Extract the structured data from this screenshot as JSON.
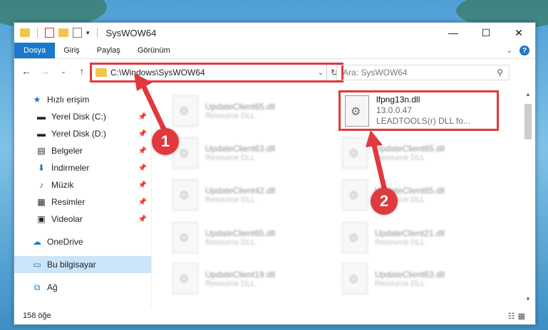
{
  "window": {
    "title": "SysWOW64"
  },
  "ribbon": {
    "tabs": [
      "Dosya",
      "Giriş",
      "Paylaş",
      "Görünüm"
    ]
  },
  "address": {
    "path": "C:\\Windows\\SysWOW64",
    "search_placeholder": "Ara: SysWOW64"
  },
  "sidebar": {
    "items": [
      {
        "label": "Hızlı erişim",
        "icon": "star-icon"
      },
      {
        "label": "Yerel Disk (C:)",
        "icon": "drive-icon"
      },
      {
        "label": "Yerel Disk (D:)",
        "icon": "drive-icon"
      },
      {
        "label": "Belgeler",
        "icon": "documents-icon"
      },
      {
        "label": "İndirmeler",
        "icon": "download-icon"
      },
      {
        "label": "Müzik",
        "icon": "music-icon"
      },
      {
        "label": "Resimler",
        "icon": "pictures-icon"
      },
      {
        "label": "Videolar",
        "icon": "videos-icon"
      },
      {
        "label": "OneDrive",
        "icon": "cloud-icon"
      },
      {
        "label": "Bu bilgisayar",
        "icon": "computer-icon"
      },
      {
        "label": "Ağ",
        "icon": "network-icon"
      }
    ]
  },
  "files_left": [
    {
      "name": "UpdateClient65.dll",
      "type": "Resource DLL"
    },
    {
      "name": "UpdateClient63.dll",
      "type": "Resource DLL"
    },
    {
      "name": "UpdateClient42.dll",
      "type": "Resource DLL"
    },
    {
      "name": "UpdateClient65.dll",
      "type": "Resource DLL"
    },
    {
      "name": "UpdateClient19.dll",
      "type": "Resource DLL"
    }
  ],
  "files_right": [
    {
      "name": "UpdateClient65.dll",
      "type": "Resource DLL"
    },
    {
      "name": "UpdateClient65.dll",
      "type": "Resource DLL"
    },
    {
      "name": "UpdateClient21.dll",
      "type": "Resource DLL"
    },
    {
      "name": "UpdateClient63.dll",
      "type": "Resource DLL"
    }
  ],
  "highlighted_file": {
    "name": "lfpng13n.dll",
    "version": "13.0.0.47",
    "description": "LEADTOOLS(r) DLL fo..."
  },
  "callouts": {
    "one": "1",
    "two": "2"
  },
  "status": {
    "item_count": "158 öğe"
  },
  "colors": {
    "accent": "#1979ca",
    "highlight": "#e0393e",
    "selected": "#cce4f7"
  }
}
